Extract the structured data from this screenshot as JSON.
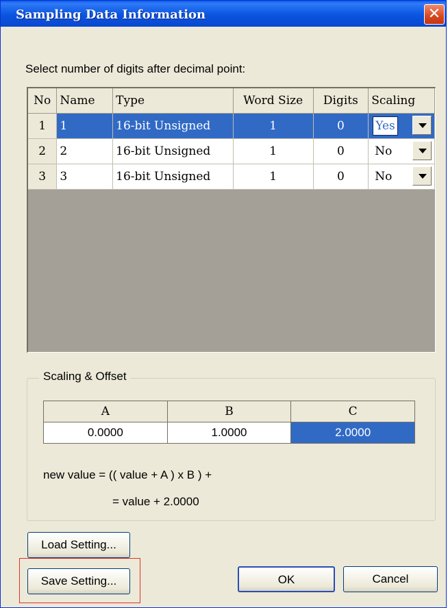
{
  "window": {
    "title": "Sampling Data Information",
    "close_glyph": "✕"
  },
  "instruction": "Select number of digits after decimal point:",
  "grid": {
    "headers": {
      "no": "No",
      "name": "Name",
      "type": "Type",
      "word_size": "Word Size",
      "digits": "Digits",
      "scaling": "Scaling"
    },
    "rows": [
      {
        "no": "1",
        "name": "1",
        "type": "16-bit Unsigned",
        "word_size": "1",
        "digits": "0",
        "scaling": "Yes"
      },
      {
        "no": "2",
        "name": "2",
        "type": "16-bit Unsigned",
        "word_size": "1",
        "digits": "0",
        "scaling": "No"
      },
      {
        "no": "3",
        "name": "3",
        "type": "16-bit Unsigned",
        "word_size": "1",
        "digits": "0",
        "scaling": "No"
      }
    ]
  },
  "scaling": {
    "group_label": "Scaling & Offset",
    "headers": {
      "a": "A",
      "b": "B",
      "c": "C"
    },
    "values": {
      "a": "0.0000",
      "b": "1.0000",
      "c": "2.0000"
    },
    "formula_line1": "new value = (( value + A ) x B ) +",
    "formula_line2": "= value + 2.0000"
  },
  "buttons": {
    "load": "Load Setting...",
    "save": "Save Setting...",
    "ok": "OK",
    "cancel": "Cancel"
  },
  "colors": {
    "titlebar": "#0a54e0",
    "selection": "#316ac5",
    "highlight": "#e0302a",
    "dialog_bg": "#ece9d8"
  }
}
